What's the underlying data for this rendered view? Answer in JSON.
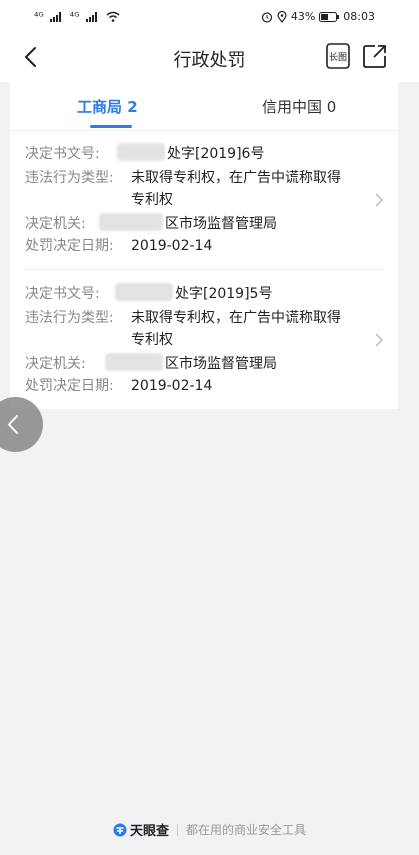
{
  "status_bar": {
    "signal1": "⁴ᴳ",
    "signal2": "⁴ᴳ",
    "battery_percent": "43%",
    "time": "08:03"
  },
  "header": {
    "title": "行政处罚",
    "long_image_label": "长图"
  },
  "tabs": [
    {
      "label": "工商局 2",
      "active": true
    },
    {
      "label": "信用中国 0",
      "active": false
    }
  ],
  "records": [
    {
      "doc_no_label": "决定书文号:",
      "doc_no_value": "处字[2019]6号",
      "violation_label": "违法行为类型:",
      "violation_value_line1": "未取得专利权，在广告中谎称取得",
      "violation_value_line2": "专利权",
      "authority_label": "决定机关:",
      "authority_value": "区市场监督管理局",
      "date_label": "处罚决定日期:",
      "date_value": "2019-02-14"
    },
    {
      "doc_no_label": "决定书文号:",
      "doc_no_value": "处字[2019]5号",
      "violation_label": "违法行为类型:",
      "violation_value_line1": "未取得专利权，在广告中谎称取得",
      "violation_value_line2": "专利权",
      "authority_label": "决定机关:",
      "authority_value": "区市场监督管理局",
      "date_label": "处罚决定日期:",
      "date_value": "2019-02-14"
    }
  ],
  "footer": {
    "brand": "天眼查",
    "slogan": "都在用的商业安全工具"
  },
  "colors": {
    "accent": "#2a7de1",
    "label": "#888888",
    "background": "#f2f2f4"
  }
}
